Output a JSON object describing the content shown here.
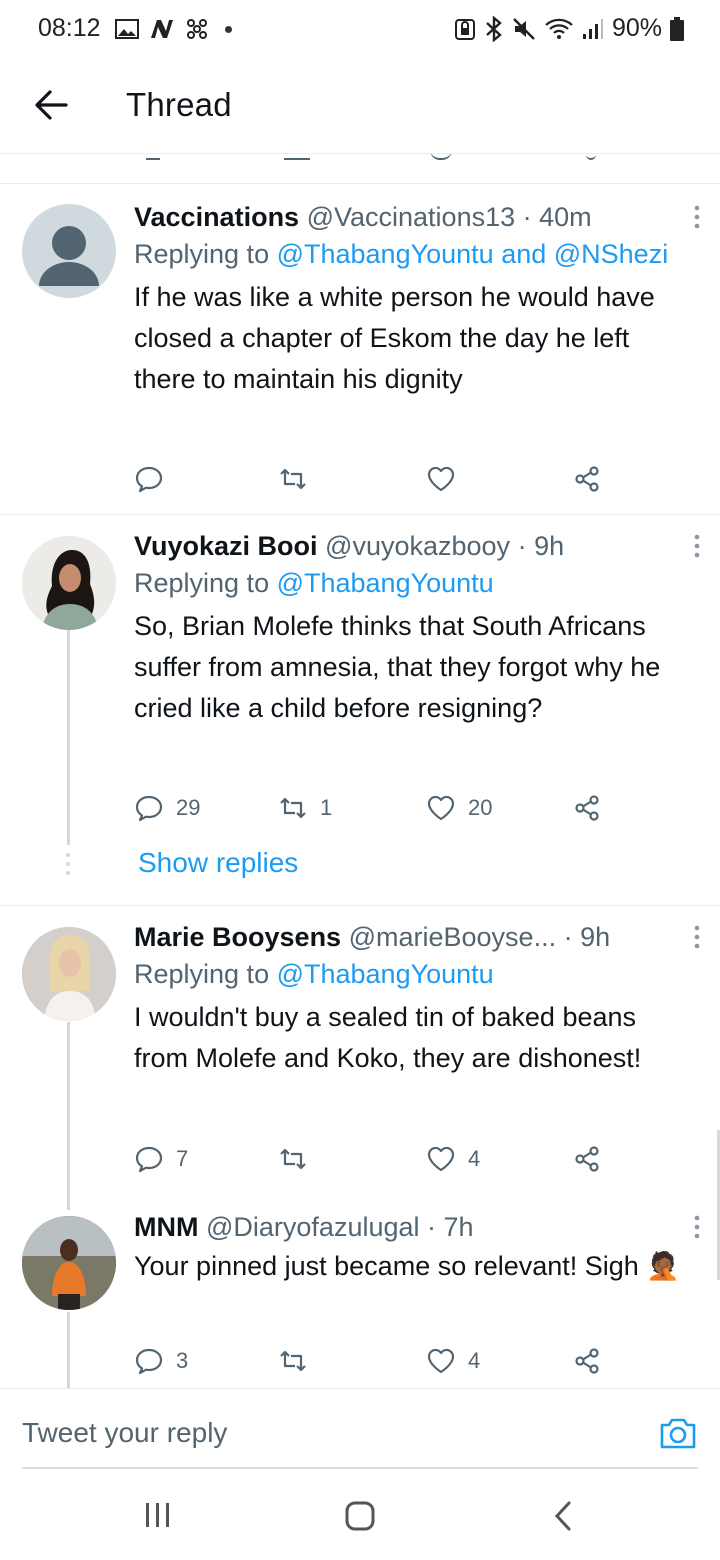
{
  "status_bar": {
    "time": "08:12",
    "battery": "90%",
    "left_icons": [
      "gallery-icon",
      "n-icon",
      "fan-icon",
      "dot-icon"
    ],
    "right_icons": [
      "lock-icon",
      "bluetooth-icon",
      "mute-icon",
      "wifi-icon",
      "signal-icon",
      "battery-icon"
    ]
  },
  "header": {
    "title": "Thread"
  },
  "tweets": [
    {
      "name": "Vaccinations",
      "handle": "@Vaccinations13",
      "time": "· 40m",
      "replying_prefix": "Replying to ",
      "replying_links": "@ThabangYountu and @NShezi",
      "text": "If he was like a white person he would have closed a chapter of Eskom the day he left there to maintain his dignity",
      "replies": "",
      "retweets": "",
      "likes": ""
    },
    {
      "name": "Vuyokazi Booi",
      "handle": "@vuyokazbooy",
      "time": "· 9h",
      "replying_prefix": "Replying to ",
      "replying_links": "@ThabangYountu",
      "text": "So, Brian Molefe thinks that South Africans suffer from amnesia, that they forgot why he cried like a child before resigning?",
      "replies": "29",
      "retweets": "1",
      "likes": "20",
      "show_replies": "Show replies"
    },
    {
      "name": "Marie Booysens",
      "handle": "@marieBooyse...",
      "time": " · 9h",
      "replying_prefix": "Replying to ",
      "replying_links": "@ThabangYountu",
      "text": "I wouldn't buy a sealed tin of baked beans from Molefe and Koko, they are dishonest!",
      "replies": "7",
      "retweets": "",
      "likes": "4"
    },
    {
      "name": "MNM",
      "handle": "@Diaryofazulugal",
      "time": "· 7h",
      "text": "Your pinned just became so relevant! Sigh",
      "emoji": "🤦🏾",
      "replies": "3",
      "retweets": "",
      "likes": "4"
    }
  ],
  "reply_bar": {
    "placeholder": "Tweet your reply"
  },
  "colors": {
    "link": "#1d9bf0",
    "secondary": "#536471",
    "text": "#0f1419",
    "divider": "#e8ecef"
  }
}
